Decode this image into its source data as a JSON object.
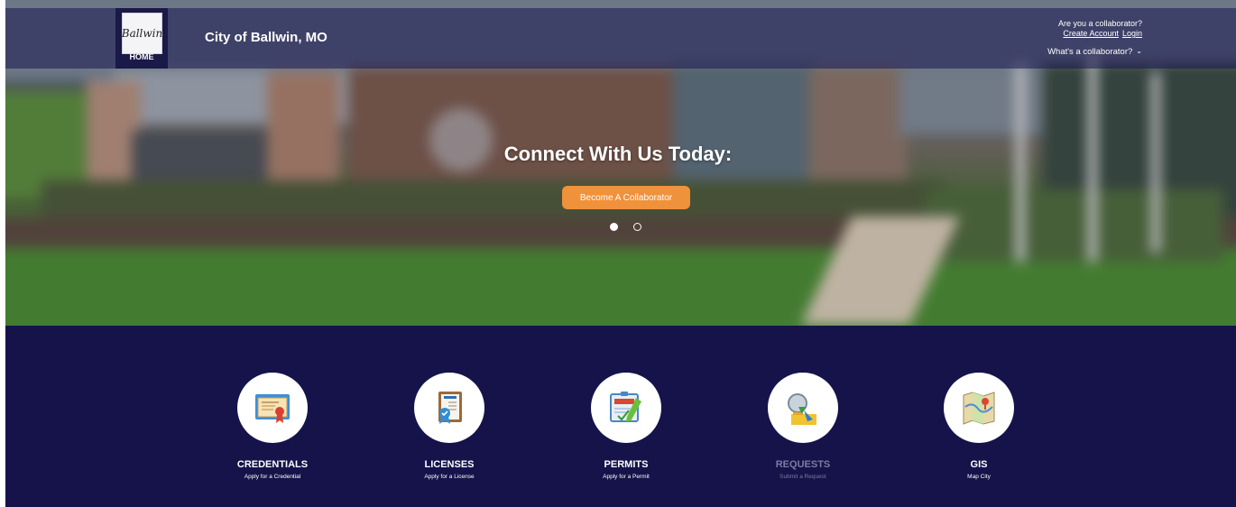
{
  "header": {
    "home_label": "HOME",
    "logo_text": "Ballwin",
    "city_title": "City of Ballwin, MO",
    "collaborator_question": "Are you a collaborator?",
    "create_account": "Create Account",
    "login": "Login",
    "whats_collaborator": "What's a collaborator?"
  },
  "hero": {
    "heading": "Connect With Us Today:",
    "cta_label": "Become A Collaborator",
    "slides_total": 2,
    "active_slide": 1
  },
  "services": [
    {
      "label": "CREDENTIALS",
      "sub": "Apply for a Credential",
      "icon": "certificate-icon",
      "enabled": true
    },
    {
      "label": "LICENSES",
      "sub": "Apply for a License",
      "icon": "license-icon",
      "enabled": true
    },
    {
      "label": "PERMITS",
      "sub": "Apply for a Permit",
      "icon": "permit-icon",
      "enabled": true
    },
    {
      "label": "REQUESTS",
      "sub": "Submit a Request",
      "icon": "request-icon",
      "enabled": false
    },
    {
      "label": "GIS",
      "sub": "Map City",
      "icon": "map-icon",
      "enabled": true
    }
  ],
  "colors": {
    "navy": "#15134a",
    "cta_orange": "#f0913b",
    "disabled_text": "#7d7ba0"
  }
}
